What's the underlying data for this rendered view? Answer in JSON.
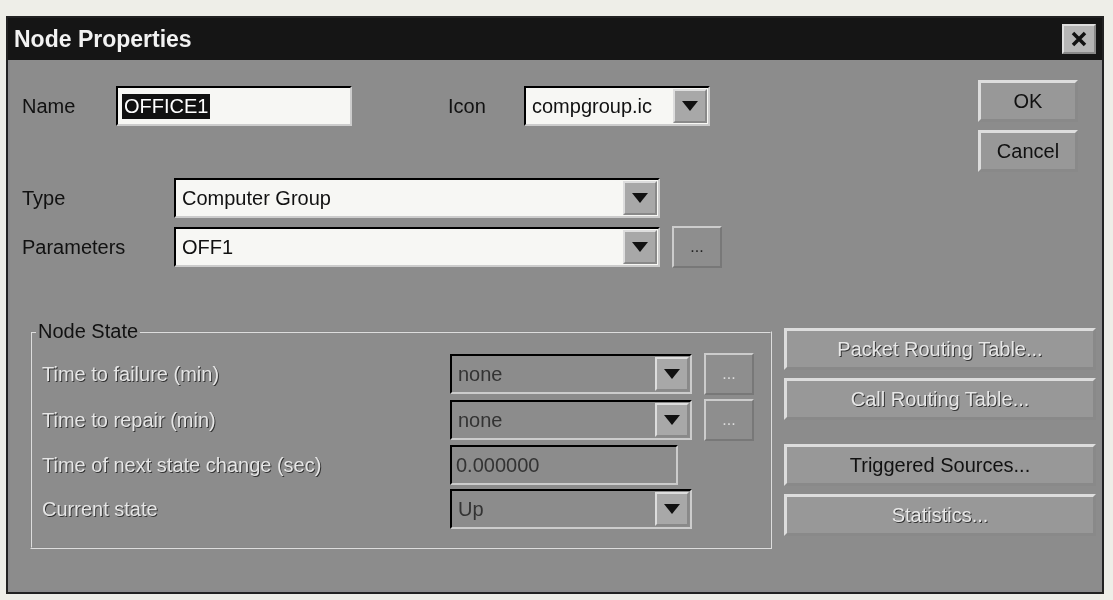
{
  "window": {
    "title": "Node Properties"
  },
  "name_field": {
    "label": "Name",
    "value": "OFFICE1",
    "highlighted": true
  },
  "icon_field": {
    "label": "Icon",
    "value": "compgroup.ic"
  },
  "dialog_buttons": [
    {
      "label": "OK",
      "disabled": false
    },
    {
      "label": "Cancel",
      "disabled": false
    }
  ],
  "type_field": {
    "label": "Type",
    "value": "Computer Group"
  },
  "parameters_field": {
    "label": "Parameters",
    "value": "OFF1",
    "browse": "..."
  },
  "node_state": {
    "title": "Node State",
    "rows": [
      {
        "kind": "combo",
        "label": "Time to failure (min)",
        "value": "none",
        "disabled": true,
        "browse": "..."
      },
      {
        "kind": "combo",
        "label": "Time to repair (min)",
        "value": "none",
        "disabled": true,
        "browse": "..."
      },
      {
        "kind": "text",
        "label": "Time of next state change (sec)",
        "value": "0.000000",
        "disabled": true
      },
      {
        "kind": "combo",
        "label": "Current state",
        "value": "Up",
        "disabled": true
      }
    ]
  },
  "action_buttons": [
    {
      "label": "Packet Routing Table...",
      "disabled": true
    },
    {
      "label": "Call Routing Table...",
      "disabled": true
    },
    {
      "label": "Triggered Sources...",
      "disabled": false
    },
    {
      "label": "Statistics...",
      "disabled": true
    }
  ]
}
